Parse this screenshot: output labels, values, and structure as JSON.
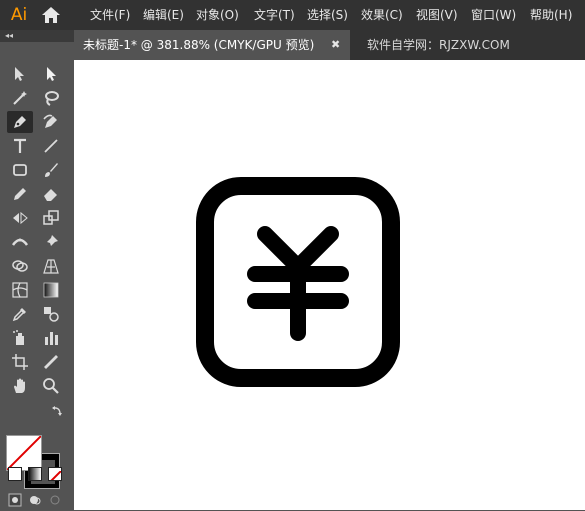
{
  "app": {
    "logo_text": "Ai",
    "brand_color": "#ff9a00"
  },
  "menu": {
    "items": [
      {
        "label": "文件(F)"
      },
      {
        "label": "编辑(E)"
      },
      {
        "label": "对象(O)"
      },
      {
        "label": "文字(T)"
      },
      {
        "label": "选择(S)"
      },
      {
        "label": "效果(C)"
      },
      {
        "label": "视图(V)"
      },
      {
        "label": "窗口(W)"
      },
      {
        "label": "帮助(H)"
      }
    ]
  },
  "tabs": {
    "document_tab": "未标题-1* @ 381.88% (CMYK/GPU 预览)",
    "close_glyph": "✖",
    "site_label": "软件自学网：RJZXW.COM"
  },
  "toolbar": {
    "collapse_glyph": "◂◂",
    "tools": [
      {
        "name": "selection-tool",
        "icon": "arrow"
      },
      {
        "name": "direct-selection-tool",
        "icon": "white-arrow"
      },
      {
        "name": "magic-wand-tool",
        "icon": "wand"
      },
      {
        "name": "lasso-tool",
        "icon": "lasso"
      },
      {
        "name": "pen-tool",
        "icon": "pen",
        "active": true
      },
      {
        "name": "curvature-tool",
        "icon": "curvature"
      },
      {
        "name": "type-tool",
        "icon": "T"
      },
      {
        "name": "line-tool",
        "icon": "line"
      },
      {
        "name": "rectangle-tool",
        "icon": "rectangle"
      },
      {
        "name": "paintbrush-tool",
        "icon": "brush"
      },
      {
        "name": "shaper-tool",
        "icon": "pencil"
      },
      {
        "name": "eraser-tool",
        "icon": "eraser"
      },
      {
        "name": "reflect-tool",
        "icon": "reflect"
      },
      {
        "name": "scale-tool",
        "icon": "scale"
      },
      {
        "name": "width-tool",
        "icon": "width"
      },
      {
        "name": "puppet-warp-tool",
        "icon": "pin"
      },
      {
        "name": "shape-builder-tool",
        "icon": "shape-builder"
      },
      {
        "name": "perspective-grid-tool",
        "icon": "perspective"
      },
      {
        "name": "mesh-tool",
        "icon": "mesh"
      },
      {
        "name": "gradient-tool",
        "icon": "gradient"
      },
      {
        "name": "eyedropper-tool",
        "icon": "eyedropper"
      },
      {
        "name": "blend-tool",
        "icon": "blend"
      },
      {
        "name": "symbol-sprayer-tool",
        "icon": "spray"
      },
      {
        "name": "column-graph-tool",
        "icon": "bar-graph"
      },
      {
        "name": "artboard-tool",
        "icon": "artboard"
      },
      {
        "name": "slice-tool",
        "icon": "slice"
      },
      {
        "name": "hand-tool",
        "icon": "hand"
      },
      {
        "name": "zoom-tool",
        "icon": "magnifier"
      }
    ]
  },
  "colors": {
    "fill": "none",
    "stroke": "#000000",
    "canvas_bg": "#ffffff",
    "ui_dark": "#323232",
    "ui_panel": "#535353"
  },
  "artwork": {
    "subject": "yen-icon"
  }
}
